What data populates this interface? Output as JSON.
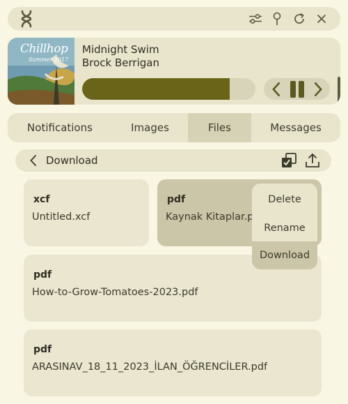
{
  "app": {
    "logo_icon": "app-logo-icon"
  },
  "toolbar": {
    "icons": [
      "settings-sliders-icon",
      "pin-icon",
      "refresh-icon",
      "close-icon"
    ]
  },
  "player": {
    "album_art_text": "Chillhop",
    "album_art_sub": "Summer 2017",
    "title": "Midnight Swim",
    "artist": "Brock Berrigan",
    "progress": 0.85,
    "controls": [
      "previous-icon",
      "pause-icon",
      "next-icon"
    ]
  },
  "tabs": [
    {
      "label": "Notifications",
      "active": false
    },
    {
      "label": "Images",
      "active": false
    },
    {
      "label": "Files",
      "active": true
    },
    {
      "label": "Messages",
      "active": false
    }
  ],
  "pathbar": {
    "label": "Download",
    "icons": [
      "back-chevron-icon",
      "select-all-icon",
      "upload-icon"
    ]
  },
  "files": [
    {
      "type": "xcf",
      "name": "Untitled.xcf"
    },
    {
      "type": "pdf",
      "name": "Kaynak Kitaplar.pdf"
    },
    {
      "type": "pdf",
      "name": "How-to-Grow-Tomatoes-2023.pdf"
    },
    {
      "type": "pdf",
      "name": "ARASINAV_18_11_2023_İLAN_ÖĞRENCİLER.pdf"
    }
  ],
  "context_menu": {
    "items": [
      "Delete",
      "Rename",
      "Download"
    ],
    "highlighted": "Download"
  },
  "colors": {
    "background": "#faf6e4",
    "surface": "#e9e5cd",
    "selected": "#cbc6a8",
    "accent": "#6a6418"
  }
}
